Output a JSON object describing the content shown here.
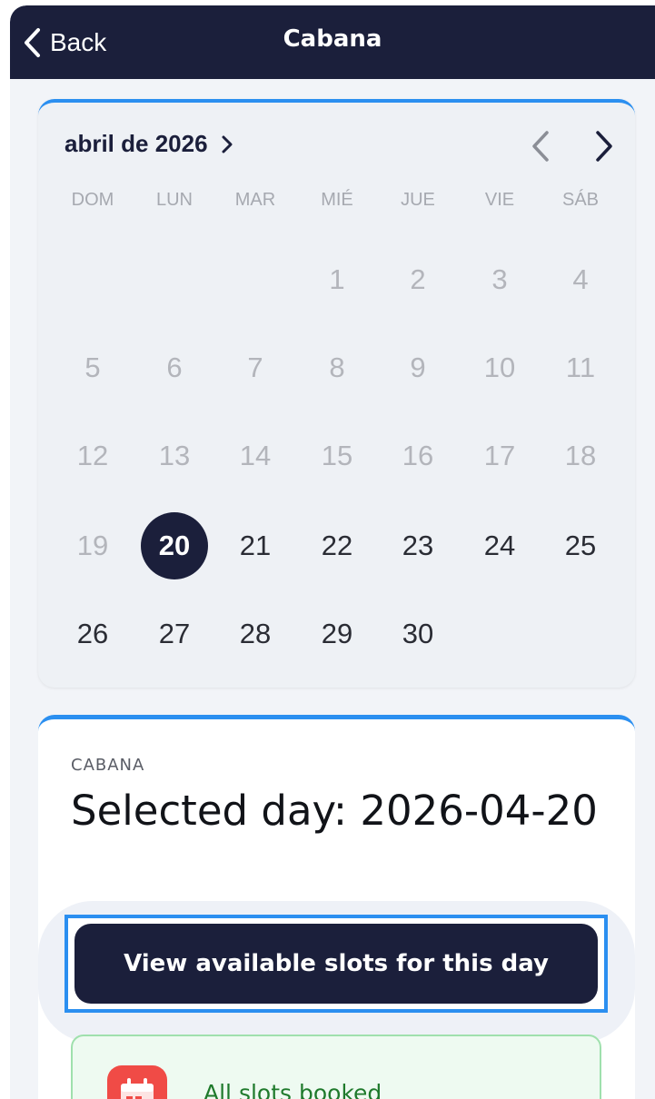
{
  "nav": {
    "back_label": "Back",
    "title": "Cabana"
  },
  "calendar": {
    "month_label": "abril de 2026",
    "weekdays": [
      "DOM",
      "LUN",
      "MAR",
      "MIÉ",
      "JUE",
      "VIE",
      "SÁB"
    ],
    "weeks": [
      [
        "",
        "",
        "",
        "1",
        "2",
        "3",
        "4"
      ],
      [
        "5",
        "6",
        "7",
        "8",
        "9",
        "10",
        "11"
      ],
      [
        "12",
        "13",
        "14",
        "15",
        "16",
        "17",
        "18"
      ],
      [
        "19",
        "20",
        "21",
        "22",
        "23",
        "24",
        "25"
      ],
      [
        "26",
        "27",
        "28",
        "29",
        "30",
        "",
        ""
      ]
    ],
    "selected_day": "20",
    "first_enabled_day": 20,
    "accent_color": "#2b8ff0",
    "selected_color": "#1b1f3b"
  },
  "detail": {
    "eyebrow": "CABANA",
    "title": "Selected day: 2026-04-20",
    "cta_label": "View available slots for this day",
    "status_text": "All slots booked",
    "status_icon": "calendar-icon",
    "status_icon_color": "#f04b46"
  }
}
